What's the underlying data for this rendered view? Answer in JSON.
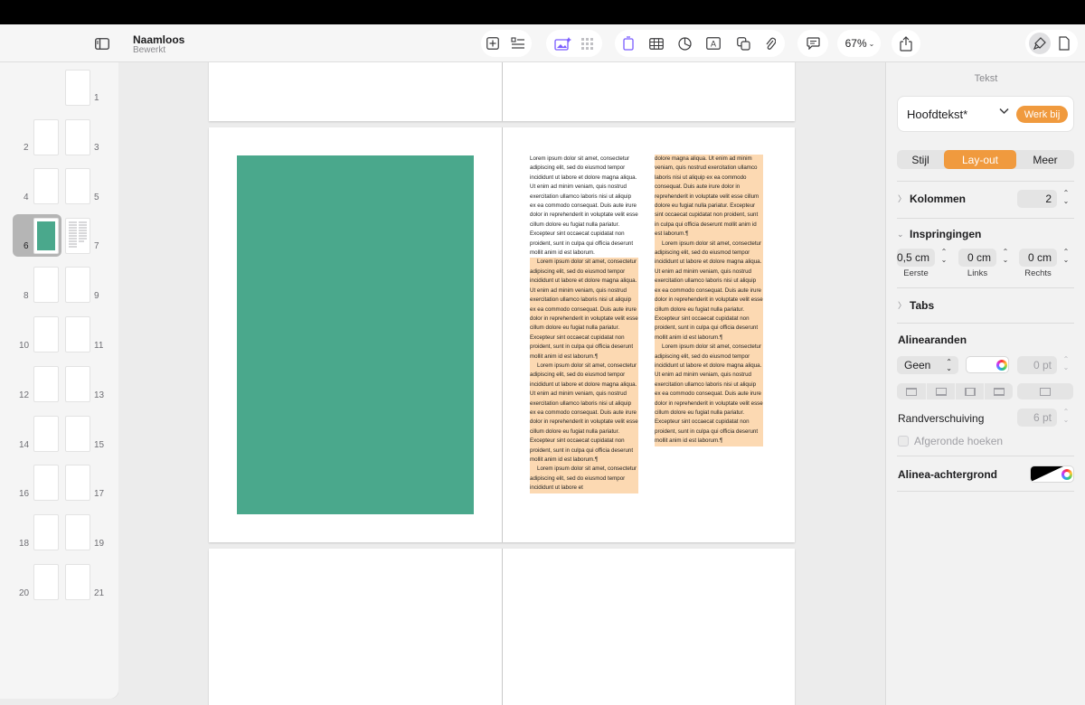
{
  "document": {
    "title": "Naamloos",
    "subtitle": "Bewerkt"
  },
  "toolbar": {
    "zoom_label": "67%",
    "icons": [
      "sidebar-toggle-icon",
      "add-page-icon",
      "outline-icon",
      "media-icon",
      "grid-icon",
      "text-box-icon",
      "table-icon",
      "chart-icon",
      "text-icon",
      "shape-icon",
      "attachment-icon",
      "comment-icon",
      "share-icon",
      "format-brush-icon",
      "document-icon"
    ]
  },
  "sidebar": {
    "pages": [
      "1",
      "2",
      "3",
      "4",
      "5",
      "6",
      "7",
      "8",
      "9",
      "10",
      "11",
      "12",
      "13",
      "14",
      "15",
      "16",
      "17",
      "18",
      "19",
      "20",
      "21"
    ],
    "selected_page": "6"
  },
  "document_body": {
    "colors": {
      "image_block": "#4aa88c",
      "highlight": "#fcd9b2"
    },
    "left_column": [
      "Lorem ipsum dolor sit amet, consectetur adipiscing elit, sed do eiusmod tempor incididunt ut labore et dolore magna aliqua. Ut enim ad minim veniam, quis nostrud exercitation ullamco laboris nisi ut aliquip ex ea commodo consequat. Duis aute irure dolor in reprehenderit in voluptate velit esse cillum dolore eu fugiat nulla pariatur. Excepteur sint occaecat cupidatat non proident, sunt in culpa qui officia deserunt mollit anim id est laborum.",
      "Lorem ipsum dolor sit amet, consectetur adipiscing elit, sed do eiusmod tempor incididunt ut labore et dolore magna aliqua. Ut enim ad minim veniam, quis nostrud exercitation ullamco laboris nisi ut aliquip ex ea commodo consequat. Duis aute irure dolor in reprehenderit in voluptate velit esse cillum dolore eu fugiat nulla pariatur. Excepteur sint occaecat cupidatat non proident, sunt in culpa qui officia deserunt mollit anim id est laborum.¶",
      "Lorem ipsum dolor sit amet, consectetur adipiscing elit, sed do eiusmod tempor incididunt ut labore et dolore magna aliqua. Ut enim ad minim veniam, quis nostrud exercitation ullamco laboris nisi ut aliquip ex ea commodo consequat. Duis aute irure dolor in reprehenderit in voluptate velit esse cillum dolore eu fugiat nulla pariatur. Excepteur sint occaecat cupidatat non proident, sunt in culpa qui officia deserunt mollit anim id est laborum.¶",
      "Lorem ipsum dolor sit amet, consectetur adipiscing elit, sed do eiusmod tempor incididunt ut labore et"
    ],
    "right_column": [
      "dolore magna aliqua. Ut enim ad minim veniam, quis nostrud exercitation ullamco laboris nisi ut aliquip ex ea commodo consequat. Duis aute irure dolor in reprehenderit in voluptate velit esse cillum dolore eu fugiat nulla pariatur. Excepteur sint occaecat cupidatat non proident, sunt in culpa qui officia deserunt mollit anim id est laborum.¶",
      "Lorem ipsum dolor sit amet, consectetur adipiscing elit, sed do eiusmod tempor incididunt ut labore et dolore magna aliqua. Ut enim ad minim veniam, quis nostrud exercitation ullamco laboris nisi ut aliquip ex ea commodo consequat. Duis aute irure dolor in reprehenderit in voluptate velit esse cillum dolore eu fugiat nulla pariatur. Excepteur sint occaecat cupidatat non proident, sunt in culpa qui officia deserunt mollit anim id est laborum.¶",
      "Lorem ipsum dolor sit amet, consectetur adipiscing elit, sed do eiusmod tempor incididunt ut labore et dolore magna aliqua. Ut enim ad minim veniam, quis nostrud exercitation ullamco laboris nisi ut aliquip ex ea commodo consequat. Duis aute irure dolor in reprehenderit in voluptate velit esse cillum dolore eu fugiat nulla pariatur. Excepteur sint occaecat cupidatat non proident, sunt in culpa qui officia deserunt mollit anim id est laborum.¶"
    ]
  },
  "panel": {
    "title": "Tekst",
    "paragraph_style": "Hoofdtekst*",
    "update_button": "Werk bij",
    "tabs": [
      "Stijl",
      "Lay-out",
      "Meer"
    ],
    "active_tab": "Lay-out",
    "columns": {
      "label": "Kolommen",
      "value": "2"
    },
    "indents": {
      "label": "Inspringingen",
      "first": {
        "value": "0,5 cm",
        "label": "Eerste"
      },
      "left": {
        "value": "0 cm",
        "label": "Links"
      },
      "right": {
        "value": "0 cm",
        "label": "Rechts"
      }
    },
    "tabs_section": {
      "label": "Tabs"
    },
    "borders": {
      "label": "Alinearanden",
      "style": "Geen",
      "width": "0 pt",
      "offset_label": "Randverschuiving",
      "offset_value": "6 pt",
      "rounded_label": "Afgeronde hoeken"
    },
    "background": {
      "label": "Alinea-achtergrond"
    },
    "accent_color": "#f09a3e"
  }
}
